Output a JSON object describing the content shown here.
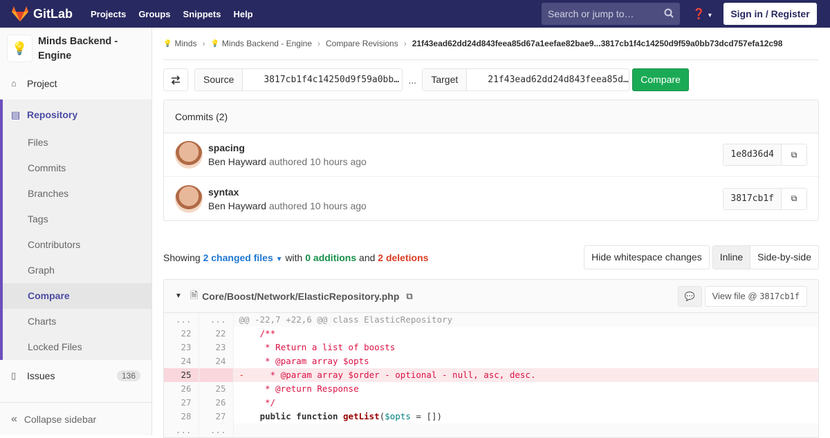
{
  "topbar": {
    "brand": "GitLab",
    "nav": [
      "Projects",
      "Groups",
      "Snippets",
      "Help"
    ],
    "search_placeholder": "Search or jump to…",
    "sign_in": "Sign in / Register"
  },
  "sidebar": {
    "project_name": "Minds Backend - Engine",
    "project_item": "Project",
    "repository": "Repository",
    "repo_items": [
      "Files",
      "Commits",
      "Branches",
      "Tags",
      "Contributors",
      "Graph",
      "Compare",
      "Charts",
      "Locked Files"
    ],
    "active_item": "Compare",
    "issues": "Issues",
    "issues_count": "136",
    "collapse": "Collapse sidebar"
  },
  "breadcrumbs": [
    "Minds",
    "Minds Backend - Engine",
    "Compare Revisions",
    "21f43ead62dd24d843feea85d67a1eefae82bae9...3817cb1f4c14250d9f59a0bb73dcd757efa12c98"
  ],
  "compare": {
    "source_label": "Source",
    "source_value": "3817cb1f4c14250d9f59a0bb73dcd757efa12c98",
    "dots": "...",
    "target_label": "Target",
    "target_value": "21f43ead62dd24d843feea85d67a1eefae82bae9",
    "button": "Compare"
  },
  "commits": {
    "header": "Commits (2)",
    "items": [
      {
        "title": "spacing",
        "author": "Ben Hayward",
        "meta": "authored 10 hours ago",
        "sha": "1e8d36d4"
      },
      {
        "title": "syntax",
        "author": "Ben Hayward",
        "meta": "authored 10 hours ago",
        "sha": "3817cb1f"
      }
    ]
  },
  "stats": {
    "showing": "Showing",
    "changed": "2 changed files",
    "with": "with",
    "additions": "0 additions",
    "and": "and",
    "deletions": "2 deletions"
  },
  "view_buttons": {
    "whitespace": "Hide whitespace changes",
    "inline": "Inline",
    "side": "Side-by-side"
  },
  "file": {
    "path": "Core/Boost/Network/ElasticRepository.php",
    "view_label": "View file @",
    "view_sha": "3817cb1f",
    "hunk": "@@ -22,7 +22,6 @@ class ElasticRepository",
    "lines": [
      {
        "old": "22",
        "new": "22",
        "text": "    /**"
      },
      {
        "old": "23",
        "new": "23",
        "text": "     * Return a list of boosts"
      },
      {
        "old": "24",
        "new": "24",
        "text": "     * @param array $opts"
      },
      {
        "old": "25",
        "new": "",
        "text": "     * @param array $order - optional - null, asc, desc."
      },
      {
        "old": "26",
        "new": "25",
        "text": "     * @return Response"
      },
      {
        "old": "27",
        "new": "26",
        "text": "     */"
      }
    ],
    "last_line": {
      "old": "28",
      "new": "27",
      "keyword": "public function",
      "name": "getList",
      "open": "(",
      "var": "$opts",
      "rest": " = [])"
    },
    "ellipsis": "..."
  }
}
